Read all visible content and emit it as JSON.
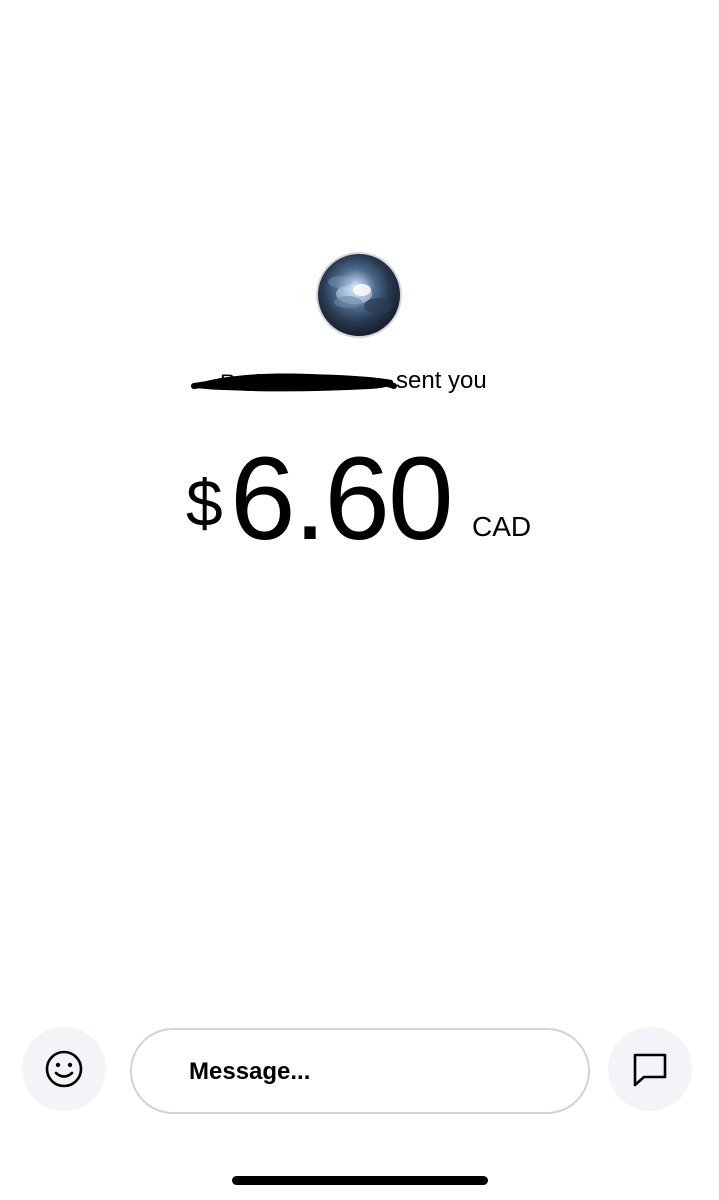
{
  "payment": {
    "sender_name": "Redacted",
    "sent_label": "sent you",
    "currency_symbol": "$",
    "amount": "6.60",
    "currency_code": "CAD"
  },
  "composer": {
    "placeholder": "Message...",
    "emoji_icon": "smiley-icon",
    "send_icon": "chat-bubble-icon"
  },
  "colors": {
    "background": "#ffffff",
    "button_background": "#f3f4f8",
    "input_border": "#d3d3d3",
    "text": "#000000"
  }
}
